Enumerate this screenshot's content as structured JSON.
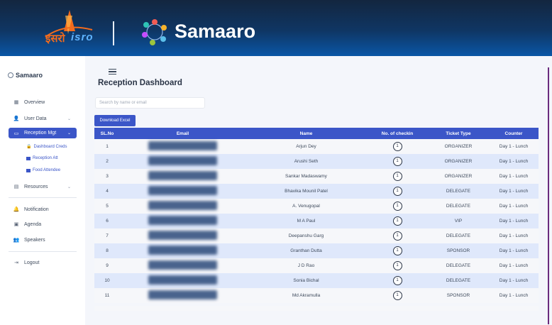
{
  "banner": {
    "isro_hi": "इसरो",
    "isro_en": "isro",
    "brand": "Samaaro"
  },
  "sidebar": {
    "brand": "Samaaro",
    "items": [
      {
        "label": "Overview",
        "icon": "grid-icon"
      },
      {
        "label": "User Data",
        "icon": "users-icon"
      },
      {
        "label": "Reception Mgt",
        "icon": "id-card-icon"
      },
      {
        "label": "Resources",
        "icon": "book-icon"
      },
      {
        "label": "Notification",
        "icon": "bell-icon"
      },
      {
        "label": "Agenda",
        "icon": "calendar-icon"
      },
      {
        "label": "Speakers",
        "icon": "people-icon"
      },
      {
        "label": "Logout",
        "icon": "logout-icon"
      }
    ],
    "sub_items": [
      {
        "label": "Dashboard Creds"
      },
      {
        "label": "Reception Att"
      },
      {
        "label": "Food Attendee"
      }
    ]
  },
  "main": {
    "title": "Reception Dashboard",
    "search_placeholder": "Search by name or email",
    "download_label": "Download Excel",
    "columns": [
      "SL.No",
      "Email",
      "Name",
      "No. of checkin",
      "Ticket Type",
      "Counter"
    ],
    "rows": [
      {
        "sl": "1",
        "name": "Arjun Dey",
        "checkin": "1",
        "type": "ORGANIZER",
        "counter": "Day 1 - Lunch"
      },
      {
        "sl": "2",
        "name": "Arushi Seth",
        "checkin": "1",
        "type": "ORGANIZER",
        "counter": "Day 1 - Lunch"
      },
      {
        "sl": "3",
        "name": "Sankar Madaswamy",
        "checkin": "1",
        "type": "ORGANIZER",
        "counter": "Day 1 - Lunch"
      },
      {
        "sl": "4",
        "name": "Bhavika Mounil Patel",
        "checkin": "1",
        "type": "DELEGATE",
        "counter": "Day 1 - Lunch"
      },
      {
        "sl": "5",
        "name": "A. Venugopal",
        "checkin": "1",
        "type": "DELEGATE",
        "counter": "Day 1 - Lunch"
      },
      {
        "sl": "6",
        "name": "M A Paul",
        "checkin": "1",
        "type": "VIP",
        "counter": "Day 1 - Lunch"
      },
      {
        "sl": "7",
        "name": "Deepanshu Garg",
        "checkin": "1",
        "type": "DELEGATE",
        "counter": "Day 1 - Lunch"
      },
      {
        "sl": "8",
        "name": "Granthan Dutta",
        "checkin": "1",
        "type": "SPONSOR",
        "counter": "Day 1 - Lunch"
      },
      {
        "sl": "9",
        "name": "J D Rao",
        "checkin": "1",
        "type": "DELEGATE",
        "counter": "Day 1 - Lunch"
      },
      {
        "sl": "10",
        "name": "Sonia Bichal",
        "checkin": "1",
        "type": "DELEGATE",
        "counter": "Day 1 - Lunch"
      },
      {
        "sl": "11",
        "name": "Md Akramulla",
        "checkin": "1",
        "type": "SPONSOR",
        "counter": "Day 1 - Lunch"
      }
    ]
  }
}
